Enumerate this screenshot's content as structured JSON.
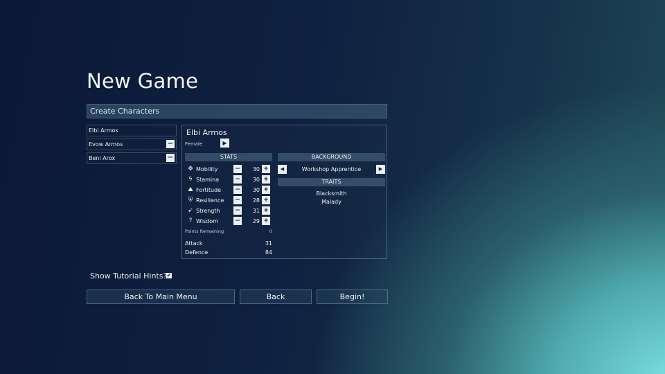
{
  "title": "New Game",
  "subheader": "Create Characters",
  "characters": [
    {
      "name": "Elbi Armos",
      "removable": false
    },
    {
      "name": "Evow Armos",
      "removable": true
    },
    {
      "name": "Beni Arox",
      "removable": true
    }
  ],
  "remove_symbol": "−",
  "selected": {
    "name": "Elbi Armos",
    "gender": "Female",
    "gender_arrow": "▶",
    "stats_header": "STATS",
    "stats": [
      {
        "icon": "mobility-icon",
        "glyph": "✥",
        "label": "Mobility",
        "value": "30"
      },
      {
        "icon": "stamina-icon",
        "glyph": "ϟ",
        "label": "Stamina",
        "value": "30"
      },
      {
        "icon": "fortitude-icon",
        "glyph": "⛰",
        "label": "Fortitude",
        "value": "30"
      },
      {
        "icon": "resilience-icon",
        "glyph": "⛨",
        "label": "Resilience",
        "value": "28"
      },
      {
        "icon": "strength-icon",
        "glyph": "➹",
        "label": "Strength",
        "value": "31"
      },
      {
        "icon": "wisdom-icon",
        "glyph": "?",
        "label": "Wisdom",
        "value": "29"
      }
    ],
    "minus_symbol": "−",
    "plus_symbol": "+",
    "points_remaining_label": "Points Remaining",
    "points_remaining_value": "0",
    "attack_label": "Attack",
    "attack_value": "31",
    "defence_label": "Defence",
    "defence_value": "84",
    "background_header": "BACKGROUND",
    "background_value": "Workshop Apprentice",
    "left_arrow": "◀",
    "right_arrow": "▶",
    "traits_header": "TRAITS",
    "traits": [
      "Blacksmith",
      "Malady"
    ]
  },
  "tutorial_label": "Show Tutorial Hints?",
  "tutorial_checked_symbol": "✔",
  "buttons": {
    "main_menu": "Back To Main Menu",
    "back": "Back",
    "begin": "Begin!"
  }
}
